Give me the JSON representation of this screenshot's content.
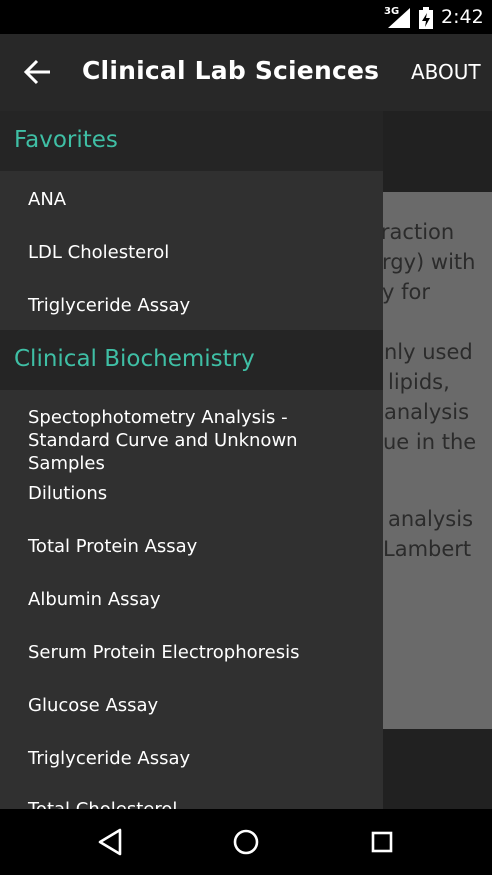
{
  "status_bar": {
    "network": "3G",
    "time": "2:42"
  },
  "app_bar": {
    "title": "Clinical Lab Sciences",
    "action": "ABOUT"
  },
  "background_text": [
    "eraction",
    "rgy) with",
    "y for",
    "nly used",
    "lipids,",
    "analysis",
    "ue in the",
    "analysis",
    "Lambert"
  ],
  "drawer": {
    "sections": [
      {
        "title": "Favorites",
        "items": [
          "ANA",
          "LDL Cholesterol",
          "Triglyceride Assay"
        ]
      },
      {
        "title": "Clinical Biochemistry",
        "items": [
          "Spectophotometry Analysis - Standard Curve and Unknown Samples",
          "Dilutions",
          "Total Protein Assay",
          "Albumin Assay",
          "Serum Protein Electrophoresis",
          "Glucose Assay",
          "Triglyceride Assay",
          "Total Cholesterol"
        ]
      }
    ]
  },
  "colors": {
    "accent": "#3fbfa5",
    "drawer_bg": "#303030",
    "header_bg": "#252525",
    "app_bar": "#282828"
  },
  "icons": {
    "back": "arrow-left-icon",
    "nav_back": "triangle-back-icon",
    "nav_home": "circle-home-icon",
    "nav_recents": "square-recents-icon"
  }
}
